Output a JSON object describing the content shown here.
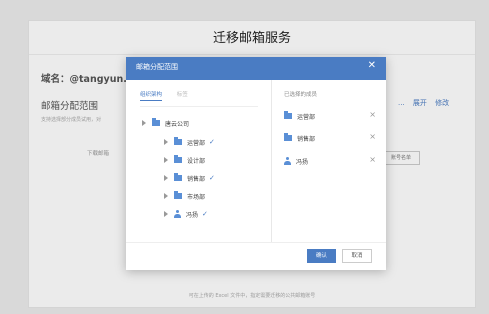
{
  "page": {
    "title": "迁移邮箱服务",
    "domain_line": "域名：@tangyun.c",
    "scope_title": "邮箱分配范围",
    "scope_desc": "支持选择部分成员试用，对",
    "links": [
      "...",
      "展开",
      "修改"
    ],
    "download_btn": "下载邮箱",
    "list_btn": "账号名单",
    "bottom_note": "可在上传的 Excel 文件中，指定需要迁移的公共邮箱账号"
  },
  "dialog": {
    "title": "邮箱分配范围",
    "close_icon": "close-icon",
    "tabs": [
      {
        "label": "组织架构",
        "active": true
      },
      {
        "label": "标签",
        "active": false
      }
    ],
    "tree": [
      {
        "label": "唐云公司",
        "icon": "folder-icon",
        "level": 0,
        "checked": false
      },
      {
        "label": "运营部",
        "icon": "folder-icon",
        "level": 1,
        "checked": true
      },
      {
        "label": "设计部",
        "icon": "folder-icon",
        "level": 1,
        "checked": false
      },
      {
        "label": "销售部",
        "icon": "folder-icon",
        "level": 1,
        "checked": true
      },
      {
        "label": "市场部",
        "icon": "folder-icon",
        "level": 1,
        "checked": false
      },
      {
        "label": "冯扬",
        "icon": "person-icon",
        "level": 1,
        "checked": true
      }
    ],
    "check_mark": "✓",
    "selected_title": "已选择的成员",
    "selected": [
      {
        "label": "运营部",
        "icon": "folder-icon"
      },
      {
        "label": "销售部",
        "icon": "folder-icon"
      },
      {
        "label": "冯扬",
        "icon": "person-icon"
      }
    ],
    "remove_mark": "×",
    "ok_label": "确认",
    "cancel_label": "取消"
  },
  "colors": {
    "accent": "#4a7cc3",
    "icon": "#5a8fd6"
  }
}
